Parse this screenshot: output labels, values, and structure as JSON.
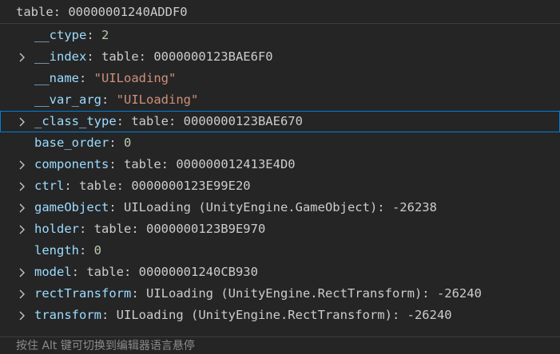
{
  "header": {
    "title": "table: 00000001240ADDF0"
  },
  "rows": [
    {
      "name": "__ctype",
      "value": "2",
      "kind": "num",
      "expandable": false,
      "selected": false
    },
    {
      "name": "__index",
      "value": "table: 0000000123BAE6F0",
      "kind": "obj",
      "expandable": true,
      "selected": false
    },
    {
      "name": "__name",
      "value": "\"UILoading\"",
      "kind": "str",
      "expandable": false,
      "selected": false
    },
    {
      "name": "__var_arg",
      "value": "\"UILoading\"",
      "kind": "str",
      "expandable": false,
      "selected": false
    },
    {
      "name": "_class_type",
      "value": "table: 0000000123BAE670",
      "kind": "obj",
      "expandable": true,
      "selected": true
    },
    {
      "name": "base_order",
      "value": "0",
      "kind": "num",
      "expandable": false,
      "selected": false
    },
    {
      "name": "components",
      "value": "table: 000000012413E4D0",
      "kind": "obj",
      "expandable": true,
      "selected": false
    },
    {
      "name": "ctrl",
      "value": "table: 0000000123E99E20",
      "kind": "obj",
      "expandable": true,
      "selected": false
    },
    {
      "name": "gameObject",
      "value": "UILoading (UnityEngine.GameObject): -26238",
      "kind": "obj",
      "expandable": true,
      "selected": false
    },
    {
      "name": "holder",
      "value": "table: 0000000123B9E970",
      "kind": "obj",
      "expandable": true,
      "selected": false
    },
    {
      "name": "length",
      "value": "0",
      "kind": "num",
      "expandable": false,
      "selected": false
    },
    {
      "name": "model",
      "value": "table: 00000001240CB930",
      "kind": "obj",
      "expandable": true,
      "selected": false
    },
    {
      "name": "rectTransform",
      "value": "UILoading (UnityEngine.RectTransform): -26240",
      "kind": "obj",
      "expandable": true,
      "selected": false
    },
    {
      "name": "transform",
      "value": "UILoading (UnityEngine.RectTransform): -26240",
      "kind": "obj",
      "expandable": true,
      "selected": false
    }
  ],
  "separator": ": ",
  "footer": {
    "hint": "按住 Alt 键可切换到编辑器语言悬停"
  },
  "icons": {
    "expand": "chevron-right-icon"
  },
  "colors": {
    "background": "#252526",
    "key": "#9cdcfe",
    "number": "#b5cea8",
    "string": "#ce9178",
    "text": "#cccccc",
    "selection_border": "#007fd4"
  }
}
